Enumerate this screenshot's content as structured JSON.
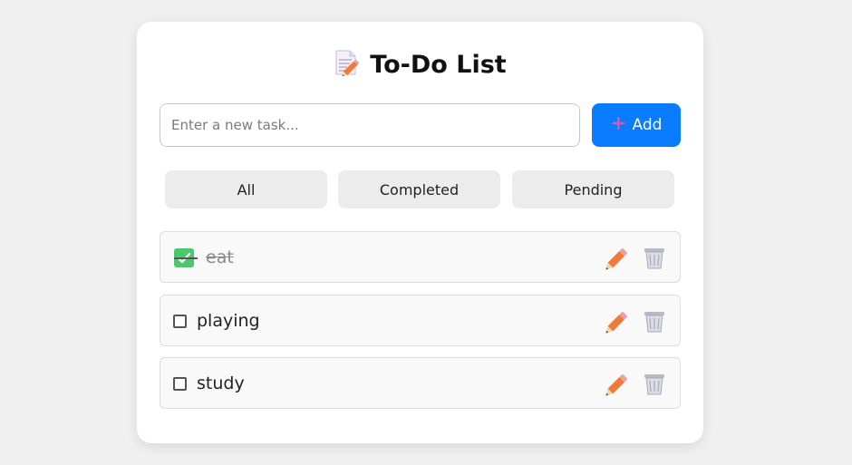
{
  "header": {
    "title": "To-Do List",
    "title_icon": "memo-icon"
  },
  "new_task": {
    "placeholder": "Enter a new task...",
    "value": "",
    "add_label": "Add",
    "add_icon": "plus-icon"
  },
  "filters": [
    {
      "label": "All"
    },
    {
      "label": "Completed"
    },
    {
      "label": "Pending"
    }
  ],
  "tasks": [
    {
      "text": "eat",
      "completed": true
    },
    {
      "text": "playing",
      "completed": false
    },
    {
      "text": "study",
      "completed": false
    }
  ],
  "task_actions": {
    "edit_icon": "pencil-icon",
    "delete_icon": "wastebasket-icon"
  },
  "colors": {
    "background": "#f0f0f0",
    "card": "#ffffff",
    "accent": "#0a7cff",
    "filter_bg": "#ececec",
    "task_bg": "#f9f9f9",
    "done_check": "#4cc76e",
    "pencil": "#f07a3a"
  }
}
